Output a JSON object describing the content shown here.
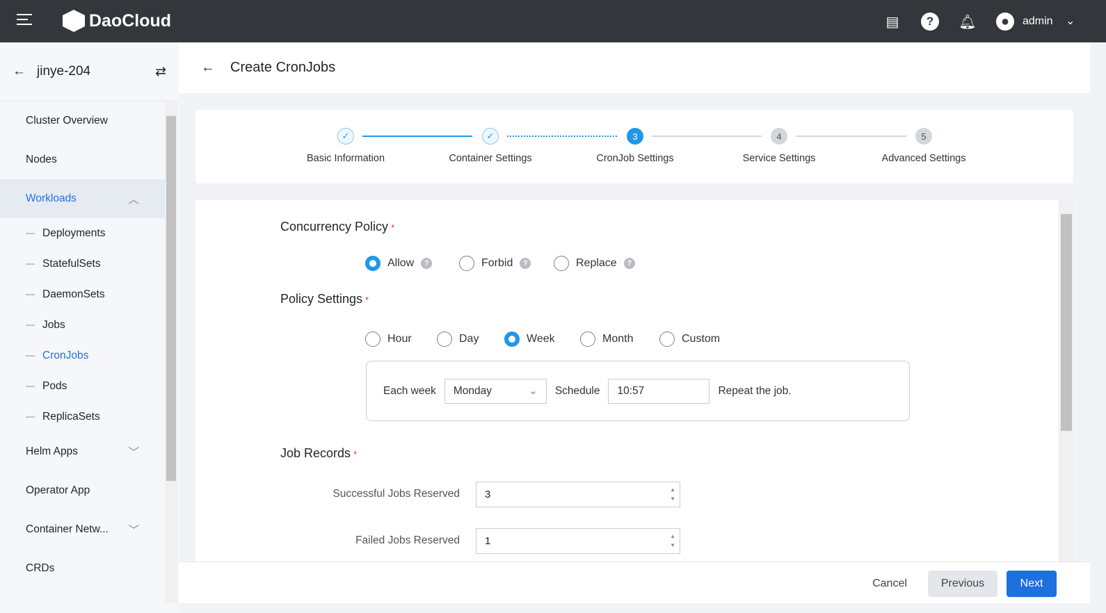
{
  "topbar": {
    "brand": "DaoCloud",
    "user": "admin"
  },
  "sidebar": {
    "cluster": "jinye-204",
    "items": [
      {
        "label": "Cluster Overview"
      },
      {
        "label": "Nodes"
      },
      {
        "label": "Workloads"
      }
    ],
    "workloads": [
      "Deployments",
      "StatefulSets",
      "DaemonSets",
      "Jobs",
      "CronJobs",
      "Pods",
      "ReplicaSets"
    ],
    "more": [
      "Helm Apps",
      "Operator App",
      "Container Netw...",
      "CRDs"
    ]
  },
  "header": {
    "title": "Create CronJobs"
  },
  "steps": [
    {
      "label": "Basic Information",
      "num": "✓"
    },
    {
      "label": "Container Settings",
      "num": "✓"
    },
    {
      "label": "CronJob Settings",
      "num": "3"
    },
    {
      "label": "Service Settings",
      "num": "4"
    },
    {
      "label": "Advanced Settings",
      "num": "5"
    }
  ],
  "form": {
    "concurrency": {
      "title": "Concurrency Policy",
      "options": [
        "Allow",
        "Forbid",
        "Replace"
      ],
      "selected": "Allow"
    },
    "policy": {
      "title": "Policy Settings",
      "options": [
        "Hour",
        "Day",
        "Week",
        "Month",
        "Custom"
      ],
      "selected": "Week",
      "each_week": "Each week",
      "day": "Monday",
      "schedule_label": "Schedule",
      "schedule": "10:57",
      "repeat": "Repeat the job."
    },
    "records": {
      "title": "Job Records",
      "success_label": "Successful Jobs Reserved",
      "success": "3",
      "failed_label": "Failed Jobs Reserved",
      "failed": "1"
    }
  },
  "footer": {
    "cancel": "Cancel",
    "previous": "Previous",
    "next": "Next"
  },
  "colors": {
    "accent": "#2196e8",
    "topbar": "#33363b"
  }
}
